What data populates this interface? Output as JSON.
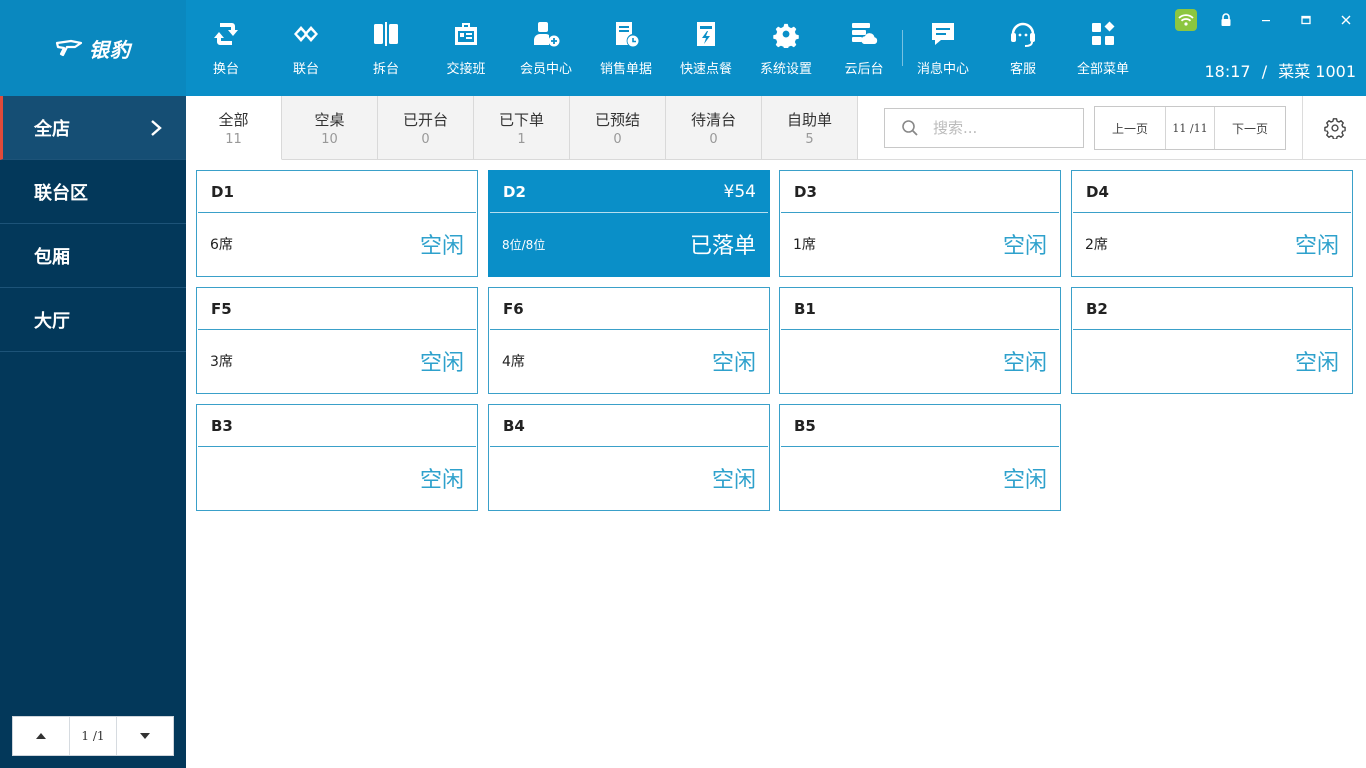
{
  "brand": {
    "logo_text": "银豹"
  },
  "toolbar": [
    {
      "key": "swap",
      "label": "换台",
      "icon": "swap-table-icon"
    },
    {
      "key": "merge",
      "label": "联台",
      "icon": "link-table-icon"
    },
    {
      "key": "split",
      "label": "拆台",
      "icon": "split-table-icon"
    },
    {
      "key": "shift",
      "label": "交接班",
      "icon": "shift-handover-icon"
    },
    {
      "key": "member",
      "label": "会员中心",
      "icon": "member-add-icon"
    },
    {
      "key": "sales",
      "label": "销售单据",
      "icon": "sales-doc-icon"
    },
    {
      "key": "quick",
      "label": "快速点餐",
      "icon": "quick-order-icon"
    },
    {
      "key": "settings",
      "label": "系统设置",
      "icon": "gear-icon"
    },
    {
      "key": "cloud",
      "label": "云后台",
      "icon": "cloud-backend-icon"
    },
    {
      "key": "messages",
      "label": "消息中心",
      "icon": "message-icon"
    },
    {
      "key": "service",
      "label": "客服",
      "icon": "headset-icon"
    },
    {
      "key": "menu",
      "label": "全部菜单",
      "icon": "all-menu-icon"
    }
  ],
  "status_bar": {
    "time": "18:17",
    "separator": "/",
    "user": "菜菜 1001"
  },
  "sidebar": {
    "items": [
      {
        "label": "全店",
        "active": true
      },
      {
        "label": "联台区",
        "active": false
      },
      {
        "label": "包厢",
        "active": false
      },
      {
        "label": "大厅",
        "active": false
      }
    ],
    "pager": {
      "text": "1 /1"
    }
  },
  "tabs": [
    {
      "label": "全部",
      "count": "11",
      "active": true
    },
    {
      "label": "空桌",
      "count": "10",
      "active": false
    },
    {
      "label": "已开台",
      "count": "0",
      "active": false
    },
    {
      "label": "已下单",
      "count": "1",
      "active": false
    },
    {
      "label": "已预结",
      "count": "0",
      "active": false
    },
    {
      "label": "待清台",
      "count": "0",
      "active": false
    },
    {
      "label": "自助单",
      "count": "5",
      "active": false
    }
  ],
  "search": {
    "placeholder": "搜索..."
  },
  "pager": {
    "prev_label": "上一页",
    "page_text": "11 /11",
    "next_label": "下一页"
  },
  "tables": [
    {
      "name": "D1",
      "amount": "",
      "seats": "6席",
      "status": "空闲",
      "busy": false
    },
    {
      "name": "D2",
      "amount": "¥54",
      "seats": "8位/8位",
      "status": "已落单",
      "busy": true
    },
    {
      "name": "D3",
      "amount": "",
      "seats": "1席",
      "status": "空闲",
      "busy": false
    },
    {
      "name": "D4",
      "amount": "",
      "seats": "2席",
      "status": "空闲",
      "busy": false
    },
    {
      "name": "F5",
      "amount": "",
      "seats": "3席",
      "status": "空闲",
      "busy": false
    },
    {
      "name": "F6",
      "amount": "",
      "seats": "4席",
      "status": "空闲",
      "busy": false
    },
    {
      "name": "B1",
      "amount": "",
      "seats": "",
      "status": "空闲",
      "busy": false
    },
    {
      "name": "B2",
      "amount": "",
      "seats": "",
      "status": "空闲",
      "busy": false
    },
    {
      "name": "B3",
      "amount": "",
      "seats": "",
      "status": "空闲",
      "busy": false
    },
    {
      "name": "B4",
      "amount": "",
      "seats": "",
      "status": "空闲",
      "busy": false
    },
    {
      "name": "B5",
      "amount": "",
      "seats": "",
      "status": "空闲",
      "busy": false
    }
  ],
  "colors": {
    "primary": "#0a8fc8",
    "sidebar": "#03385a",
    "idle_text": "#2ea1cc",
    "active_marker": "#e04a3a",
    "wifi": "#8cc63f"
  }
}
